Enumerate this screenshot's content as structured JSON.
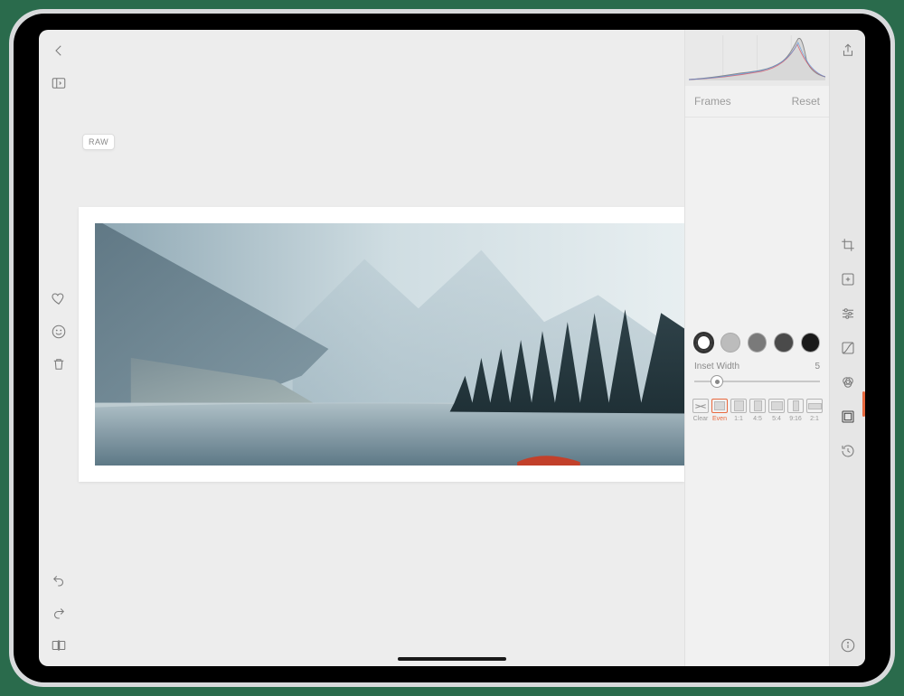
{
  "badge_raw": "RAW",
  "panel": {
    "title": "Frames",
    "reset": "Reset"
  },
  "inset": {
    "label": "Inset Width",
    "value": "5",
    "thumb_percent": 18
  },
  "swatches": [
    {
      "name": "white",
      "selected": true
    },
    {
      "name": "light-gray",
      "selected": false
    },
    {
      "name": "gray",
      "selected": false
    },
    {
      "name": "dark-gray",
      "selected": false
    },
    {
      "name": "black",
      "selected": false
    }
  ],
  "ratios": [
    {
      "label": "Clear",
      "key": "clear"
    },
    {
      "label": "Even",
      "key": "even",
      "selected": true
    },
    {
      "label": "1:1",
      "key": "1-1"
    },
    {
      "label": "4:5",
      "key": "4-5"
    },
    {
      "label": "5:4",
      "key": "5-4"
    },
    {
      "label": "9:16",
      "key": "9-16"
    },
    {
      "label": "2:1",
      "key": "2-1"
    }
  ],
  "left_rail": {
    "top": [
      "back-icon",
      "sidebar-toggle-icon"
    ],
    "middle": [
      "heart-icon",
      "smiley-icon",
      "trash-icon"
    ],
    "bottom": [
      "undo-icon",
      "redo-icon",
      "compare-icon"
    ]
  },
  "right_rail": {
    "share": "share-icon",
    "tools": [
      "crop-icon",
      "exposure-icon",
      "sliders-icon",
      "curves-icon",
      "color-mix-icon",
      "frames-icon",
      "history-icon"
    ],
    "active_tool": "frames-icon",
    "bottom": [
      "info-icon"
    ]
  },
  "colors": {
    "accent": "#e8693f"
  }
}
